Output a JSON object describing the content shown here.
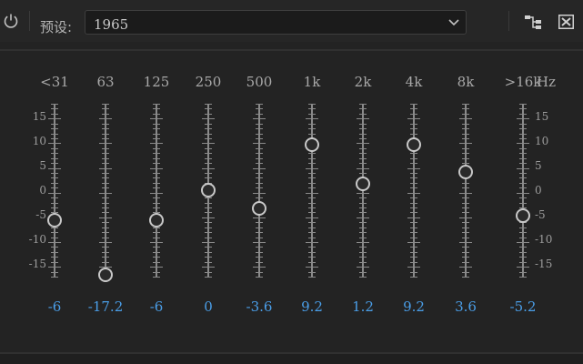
{
  "header": {
    "preset_label": "预设:",
    "preset_value": "1965",
    "icons": [
      "power-icon",
      "chevron-down-icon",
      "routing-icon",
      "reset-icon"
    ]
  },
  "eq": {
    "gain_range": [
      -17.5,
      17.5
    ],
    "scale_ticks": [
      "15",
      "10",
      "5",
      "0",
      "-5",
      "-10",
      "-15"
    ],
    "hz_label": "Hz",
    "bands": [
      {
        "label": "<31",
        "gain": -6,
        "gain_text": "-6"
      },
      {
        "label": "63",
        "gain": -17.2,
        "gain_text": "-17.2"
      },
      {
        "label": "125",
        "gain": -6,
        "gain_text": "-6"
      },
      {
        "label": "250",
        "gain": 0,
        "gain_text": "0"
      },
      {
        "label": "500",
        "gain": -3.6,
        "gain_text": "-3.6"
      },
      {
        "label": "1k",
        "gain": 9.2,
        "gain_text": "9.2"
      },
      {
        "label": "2k",
        "gain": 1.2,
        "gain_text": "1.2"
      },
      {
        "label": "4k",
        "gain": 9.2,
        "gain_text": "9.2"
      },
      {
        "label": "8k",
        "gain": 3.6,
        "gain_text": "3.6"
      },
      {
        "label": ">16k",
        "gain": -5.2,
        "gain_text": "-5.2"
      }
    ]
  },
  "colors": {
    "background": "#232323",
    "gain_value": "#4a9ee8",
    "track": "#8a8a8a",
    "knob": "#c8c8c8"
  }
}
